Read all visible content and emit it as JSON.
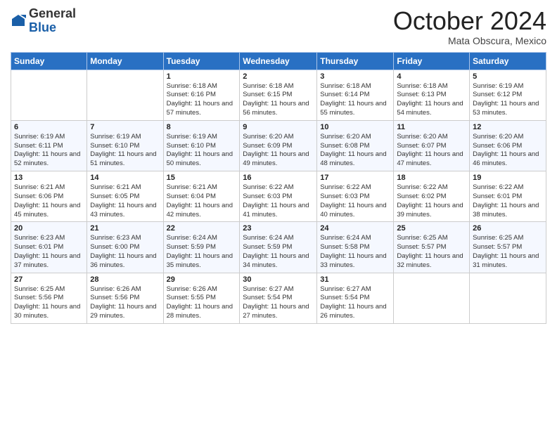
{
  "logo": {
    "general": "General",
    "blue": "Blue"
  },
  "header": {
    "month": "October 2024",
    "location": "Mata Obscura, Mexico"
  },
  "weekdays": [
    "Sunday",
    "Monday",
    "Tuesday",
    "Wednesday",
    "Thursday",
    "Friday",
    "Saturday"
  ],
  "weeks": [
    [
      {
        "day": "",
        "info": ""
      },
      {
        "day": "",
        "info": ""
      },
      {
        "day": "1",
        "info": "Sunrise: 6:18 AM\nSunset: 6:16 PM\nDaylight: 11 hours and 57 minutes."
      },
      {
        "day": "2",
        "info": "Sunrise: 6:18 AM\nSunset: 6:15 PM\nDaylight: 11 hours and 56 minutes."
      },
      {
        "day": "3",
        "info": "Sunrise: 6:18 AM\nSunset: 6:14 PM\nDaylight: 11 hours and 55 minutes."
      },
      {
        "day": "4",
        "info": "Sunrise: 6:18 AM\nSunset: 6:13 PM\nDaylight: 11 hours and 54 minutes."
      },
      {
        "day": "5",
        "info": "Sunrise: 6:19 AM\nSunset: 6:12 PM\nDaylight: 11 hours and 53 minutes."
      }
    ],
    [
      {
        "day": "6",
        "info": "Sunrise: 6:19 AM\nSunset: 6:11 PM\nDaylight: 11 hours and 52 minutes."
      },
      {
        "day": "7",
        "info": "Sunrise: 6:19 AM\nSunset: 6:10 PM\nDaylight: 11 hours and 51 minutes."
      },
      {
        "day": "8",
        "info": "Sunrise: 6:19 AM\nSunset: 6:10 PM\nDaylight: 11 hours and 50 minutes."
      },
      {
        "day": "9",
        "info": "Sunrise: 6:20 AM\nSunset: 6:09 PM\nDaylight: 11 hours and 49 minutes."
      },
      {
        "day": "10",
        "info": "Sunrise: 6:20 AM\nSunset: 6:08 PM\nDaylight: 11 hours and 48 minutes."
      },
      {
        "day": "11",
        "info": "Sunrise: 6:20 AM\nSunset: 6:07 PM\nDaylight: 11 hours and 47 minutes."
      },
      {
        "day": "12",
        "info": "Sunrise: 6:20 AM\nSunset: 6:06 PM\nDaylight: 11 hours and 46 minutes."
      }
    ],
    [
      {
        "day": "13",
        "info": "Sunrise: 6:21 AM\nSunset: 6:06 PM\nDaylight: 11 hours and 45 minutes."
      },
      {
        "day": "14",
        "info": "Sunrise: 6:21 AM\nSunset: 6:05 PM\nDaylight: 11 hours and 43 minutes."
      },
      {
        "day": "15",
        "info": "Sunrise: 6:21 AM\nSunset: 6:04 PM\nDaylight: 11 hours and 42 minutes."
      },
      {
        "day": "16",
        "info": "Sunrise: 6:22 AM\nSunset: 6:03 PM\nDaylight: 11 hours and 41 minutes."
      },
      {
        "day": "17",
        "info": "Sunrise: 6:22 AM\nSunset: 6:03 PM\nDaylight: 11 hours and 40 minutes."
      },
      {
        "day": "18",
        "info": "Sunrise: 6:22 AM\nSunset: 6:02 PM\nDaylight: 11 hours and 39 minutes."
      },
      {
        "day": "19",
        "info": "Sunrise: 6:22 AM\nSunset: 6:01 PM\nDaylight: 11 hours and 38 minutes."
      }
    ],
    [
      {
        "day": "20",
        "info": "Sunrise: 6:23 AM\nSunset: 6:01 PM\nDaylight: 11 hours and 37 minutes."
      },
      {
        "day": "21",
        "info": "Sunrise: 6:23 AM\nSunset: 6:00 PM\nDaylight: 11 hours and 36 minutes."
      },
      {
        "day": "22",
        "info": "Sunrise: 6:24 AM\nSunset: 5:59 PM\nDaylight: 11 hours and 35 minutes."
      },
      {
        "day": "23",
        "info": "Sunrise: 6:24 AM\nSunset: 5:59 PM\nDaylight: 11 hours and 34 minutes."
      },
      {
        "day": "24",
        "info": "Sunrise: 6:24 AM\nSunset: 5:58 PM\nDaylight: 11 hours and 33 minutes."
      },
      {
        "day": "25",
        "info": "Sunrise: 6:25 AM\nSunset: 5:57 PM\nDaylight: 11 hours and 32 minutes."
      },
      {
        "day": "26",
        "info": "Sunrise: 6:25 AM\nSunset: 5:57 PM\nDaylight: 11 hours and 31 minutes."
      }
    ],
    [
      {
        "day": "27",
        "info": "Sunrise: 6:25 AM\nSunset: 5:56 PM\nDaylight: 11 hours and 30 minutes."
      },
      {
        "day": "28",
        "info": "Sunrise: 6:26 AM\nSunset: 5:56 PM\nDaylight: 11 hours and 29 minutes."
      },
      {
        "day": "29",
        "info": "Sunrise: 6:26 AM\nSunset: 5:55 PM\nDaylight: 11 hours and 28 minutes."
      },
      {
        "day": "30",
        "info": "Sunrise: 6:27 AM\nSunset: 5:54 PM\nDaylight: 11 hours and 27 minutes."
      },
      {
        "day": "31",
        "info": "Sunrise: 6:27 AM\nSunset: 5:54 PM\nDaylight: 11 hours and 26 minutes."
      },
      {
        "day": "",
        "info": ""
      },
      {
        "day": "",
        "info": ""
      }
    ]
  ]
}
